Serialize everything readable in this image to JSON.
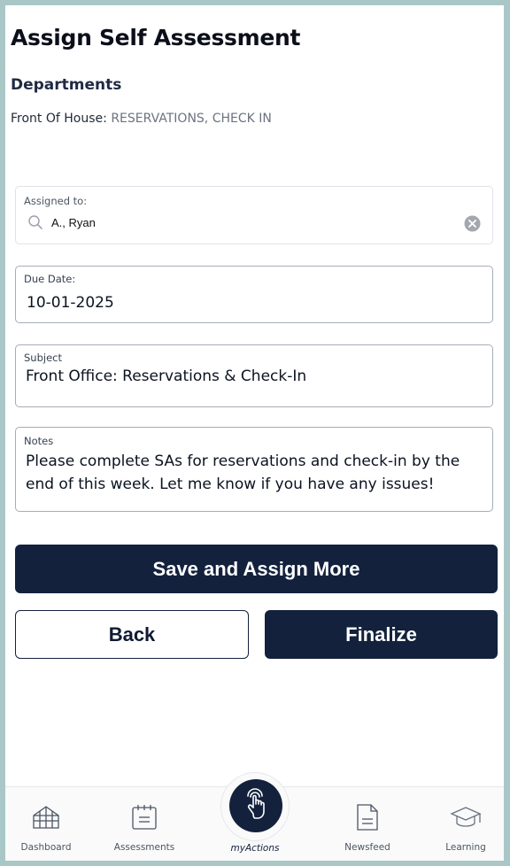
{
  "header": {
    "title": "Assign Self Assessment"
  },
  "departments": {
    "heading": "Departments",
    "label": "Front Of House:",
    "value": "RESERVATIONS, CHECK IN"
  },
  "form": {
    "assigned": {
      "label": "Assigned to:",
      "value": "A., Ryan"
    },
    "due": {
      "label": "Due Date:",
      "value": "10-01-2025"
    },
    "subject": {
      "label": "Subject",
      "value": "Front Office: Reservations & Check-In"
    },
    "notes": {
      "label": "Notes",
      "value": "Please complete SAs for reservations and check-in by the end of this week. Let me know if you have any issues!"
    }
  },
  "buttons": {
    "save_more": "Save and Assign More",
    "back": "Back",
    "finalize": "Finalize"
  },
  "nav": {
    "items": [
      {
        "label": "Dashboard",
        "icon": "dashboard-icon"
      },
      {
        "label": "Assessments",
        "icon": "assessments-icon"
      },
      {
        "label": "myActions",
        "icon": "tap-hand-icon",
        "active": true
      },
      {
        "label": "Newsfeed",
        "icon": "newsfeed-icon"
      },
      {
        "label": "Learning",
        "icon": "graduation-cap-icon"
      }
    ]
  },
  "colors": {
    "navy": "#13213d",
    "background": "#a9c7c6"
  }
}
